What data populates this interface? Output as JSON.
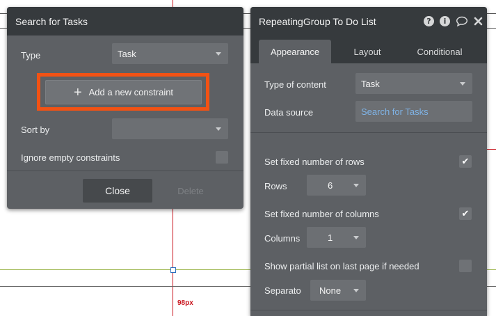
{
  "canvas": {
    "dimension_label": "98px"
  },
  "search_panel": {
    "title": "Search for Tasks",
    "type_label": "Type",
    "type_value": "Task",
    "add_constraint_label": "Add a new constraint",
    "sort_by_label": "Sort by",
    "sort_by_value": "",
    "ignore_empty_label": "Ignore empty constraints",
    "ignore_empty_checked": false,
    "close_label": "Close",
    "delete_label": "Delete"
  },
  "property_panel": {
    "title": "RepeatingGroup To Do List",
    "icons": [
      "help-icon",
      "info-icon",
      "comment-icon",
      "close-icon"
    ],
    "tabs": [
      {
        "label": "Appearance",
        "active": true
      },
      {
        "label": "Layout",
        "active": false
      },
      {
        "label": "Conditional",
        "active": false
      }
    ],
    "type_of_content_label": "Type of content",
    "type_of_content_value": "Task",
    "data_source_label": "Data source",
    "data_source_value": "Search for Tasks",
    "fixed_rows_label": "Set fixed number of rows",
    "fixed_rows_checked": true,
    "rows_label": "Rows",
    "rows_value": "6",
    "fixed_columns_label": "Set fixed number of columns",
    "fixed_columns_checked": true,
    "columns_label": "Columns",
    "columns_value": "1",
    "partial_list_label": "Show partial list on last page if needed",
    "partial_list_checked": false,
    "separator_label": "Separato",
    "separator_value": "None",
    "checkmark": "✔"
  },
  "colors": {
    "panel_bg": "#5d6064",
    "panel_header": "#363a3d",
    "highlight": "#f25214",
    "link": "#7fb3e6"
  }
}
